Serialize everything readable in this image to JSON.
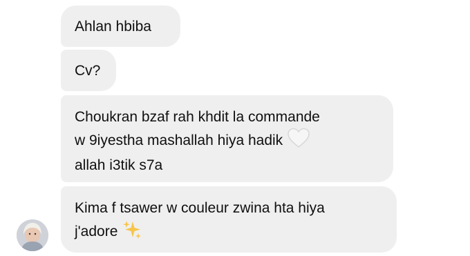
{
  "thread": {
    "messages": [
      {
        "lines": [
          "Ahlan hbiba"
        ]
      },
      {
        "lines": [
          "Cv?"
        ]
      },
      {
        "lines": [
          "Choukran bzaf rah khdit la commande",
          "w 9iyestha mashallah hiya hadik",
          "allah i3tik s7a"
        ],
        "emoji_after_line_2": "white-heart-icon"
      },
      {
        "lines": [
          "Kima f tsawer w couleur zwina hta hiya",
          "j'adore"
        ],
        "emoji_after_line_2": "sparkles-icon"
      }
    ]
  },
  "avatar": {
    "icon": "user-avatar"
  },
  "colors": {
    "bubble_bg": "#efefef",
    "text": "#0f0f0f",
    "sparkles": "#f7c54a"
  }
}
